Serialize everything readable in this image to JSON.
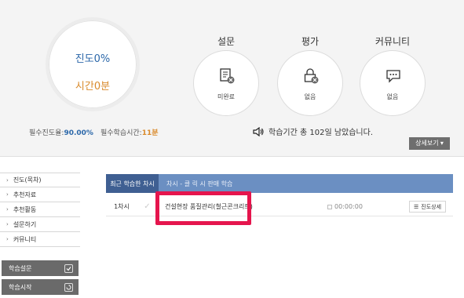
{
  "progress": {
    "percent_text": "진도0%",
    "time_text": "시간0분"
  },
  "requirements": {
    "progress_label": "필수진도율:",
    "progress_value": "90.00%",
    "time_label": "필수학습시간:",
    "time_value": "11분"
  },
  "sections": [
    {
      "title": "설문",
      "status": "미완료",
      "icon": "survey-icon"
    },
    {
      "title": "평가",
      "status": "없음",
      "icon": "exam-lock-icon"
    },
    {
      "title": "커뮤니티",
      "status": "없음",
      "icon": "chat-icon"
    }
  ],
  "study_period": "학습기간 총 102일 남았습니다.",
  "detail_button": "상세보기",
  "menu": [
    "진도(목차)",
    "추천자료",
    "추천활동",
    "설문하기",
    "커뮤니티"
  ],
  "side_buttons": [
    {
      "label": "학습설문",
      "icon": "check-icon"
    },
    {
      "label": "학습시작",
      "icon": "refresh-icon"
    }
  ],
  "table": {
    "header_recent": "최근 학습한 차시",
    "header_note": "차시 - 클 릭 시 판매 학습",
    "rows": [
      {
        "no": "1차시",
        "title": "건설현장 품질관리(철근콘크리트)",
        "time": "00:00:00",
        "detail": "진도상세"
      }
    ]
  },
  "colors": {
    "accent_blue": "#2b67a9",
    "accent_orange": "#d98a2b",
    "highlight": "#e5154d",
    "table_header": "#6b8fc2"
  }
}
